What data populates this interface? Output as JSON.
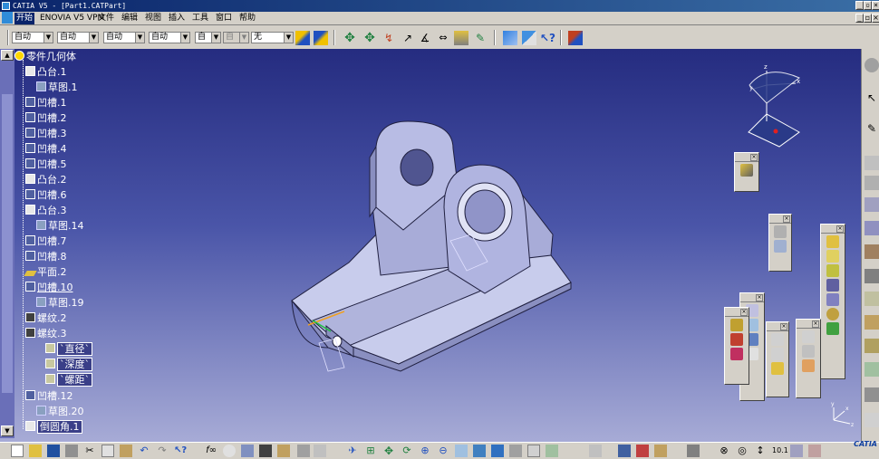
{
  "window": {
    "title": "CATIA V5 - [Part1.CATPart]"
  },
  "menu": [
    "开始",
    "ENOVIA V5 VPM",
    "文件",
    "编辑",
    "视图",
    "插入",
    "工具",
    "窗口",
    "帮助"
  ],
  "properties_toolbar": {
    "combos": [
      "自动",
      "自动",
      "自动",
      "自动",
      "自",
      "自",
      "无"
    ]
  },
  "tree": {
    "root": "零件几何体",
    "items": [
      {
        "label": "凸台.1",
        "icon": "boss-icon",
        "level": 1
      },
      {
        "label": "草图.1",
        "icon": "sketch-icon",
        "level": 2
      },
      {
        "label": "凹槽.1",
        "icon": "pocket-icon",
        "level": 1
      },
      {
        "label": "凹槽.2",
        "icon": "pocket-icon",
        "level": 1
      },
      {
        "label": "凹槽.3",
        "icon": "pocket-icon",
        "level": 1
      },
      {
        "label": "凹槽.4",
        "icon": "pocket-icon",
        "level": 1
      },
      {
        "label": "凹槽.5",
        "icon": "pocket-icon",
        "level": 1
      },
      {
        "label": "凸台.2",
        "icon": "boss-icon",
        "level": 1
      },
      {
        "label": "凹槽.6",
        "icon": "pocket-icon",
        "level": 1
      },
      {
        "label": "凸台.3",
        "icon": "boss-icon",
        "level": 1
      },
      {
        "label": "草图.14",
        "icon": "sketch-icon",
        "level": 2
      },
      {
        "label": "凹槽.7",
        "icon": "pocket-icon",
        "level": 1
      },
      {
        "label": "凹槽.8",
        "icon": "pocket-icon",
        "level": 1
      },
      {
        "label": "平面.2",
        "icon": "plane-icon",
        "level": 1
      },
      {
        "label": "凹槽.10",
        "icon": "pocket-icon",
        "level": 1,
        "style": "under"
      },
      {
        "label": "草图.19",
        "icon": "sketch-icon",
        "level": 2
      },
      {
        "label": "螺纹.2",
        "icon": "thread-icon",
        "level": 1
      },
      {
        "label": "螺纹.3",
        "icon": "thread-icon",
        "level": 1
      },
      {
        "label": "`直径`",
        "icon": "parameter-icon",
        "level": 2,
        "style": "boxed"
      },
      {
        "label": "`深度`",
        "icon": "parameter-icon",
        "level": 2,
        "style": "boxed"
      },
      {
        "label": "`螺距`",
        "icon": "parameter-icon",
        "level": 2,
        "style": "boxed"
      },
      {
        "label": "凹槽.12",
        "icon": "pocket-icon",
        "level": 1
      },
      {
        "label": "草图.20",
        "icon": "sketch-icon",
        "level": 2
      },
      {
        "label": "倒圆角.1",
        "icon": "fillet-icon",
        "level": 1,
        "style": "boxed"
      }
    ]
  },
  "compass": {
    "labels": [
      "z",
      "y",
      "x"
    ]
  },
  "corner_axis": {
    "labels": [
      "y",
      "x",
      "z"
    ]
  },
  "logo_text": "CATIA"
}
